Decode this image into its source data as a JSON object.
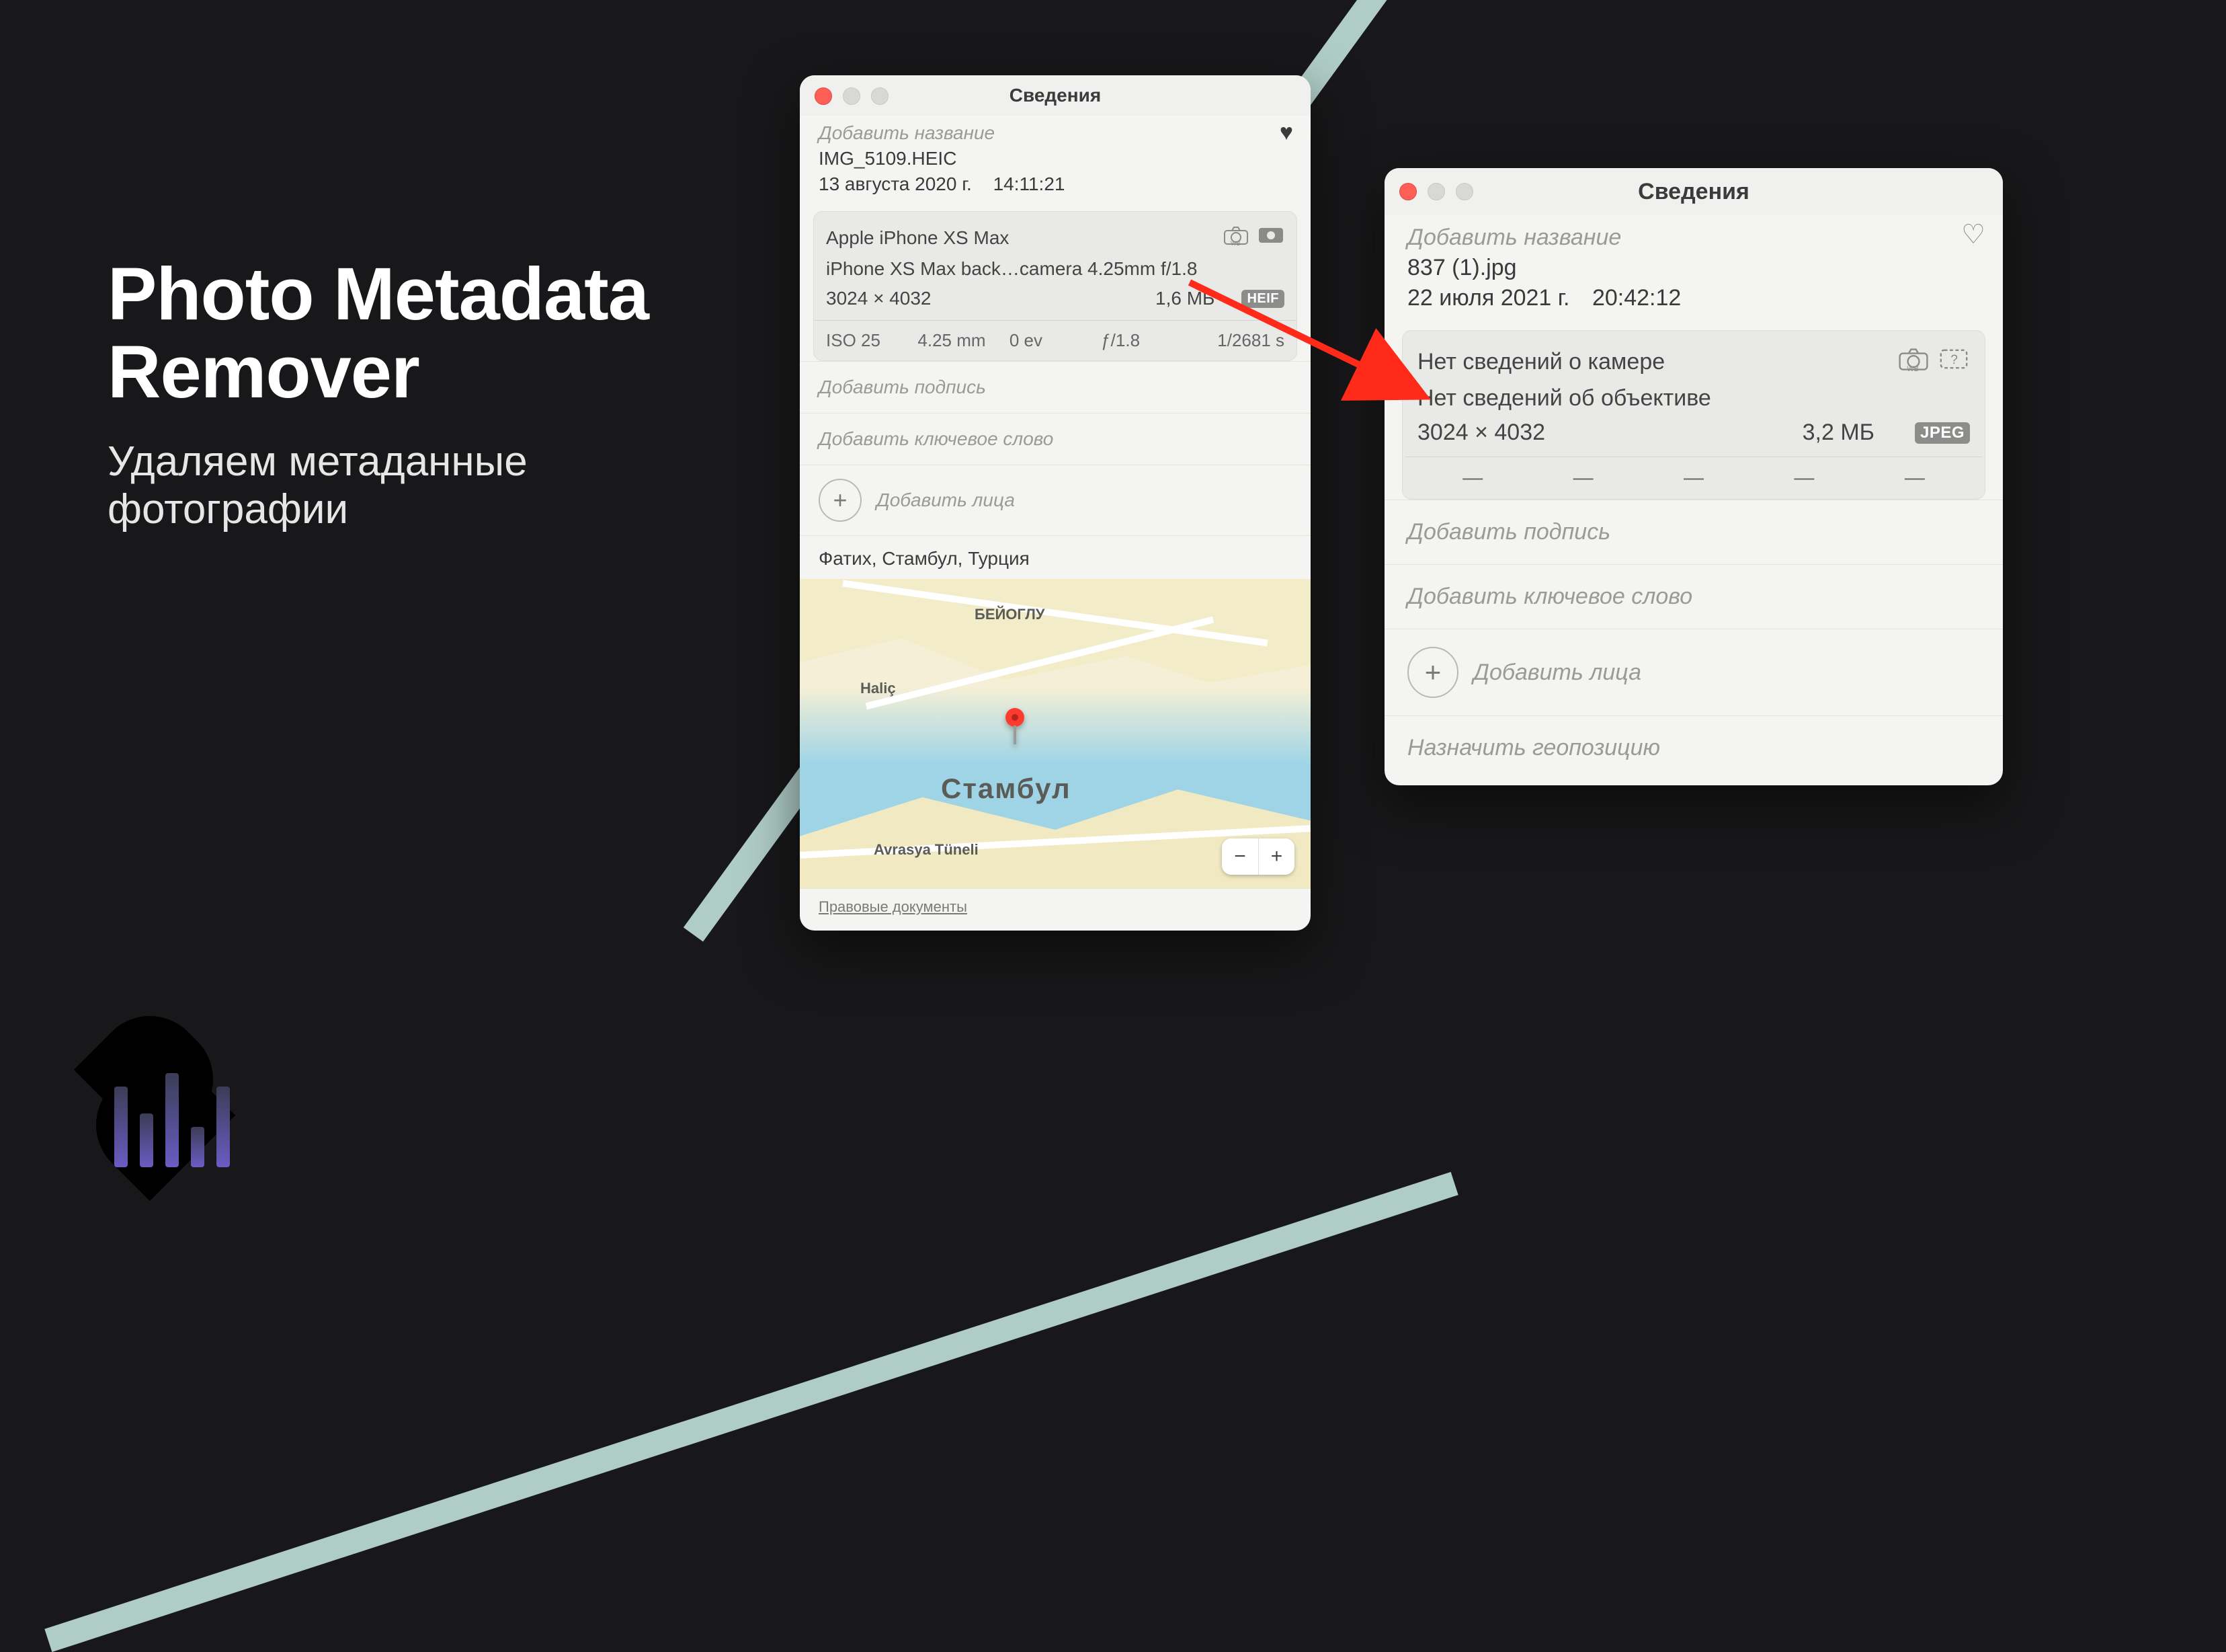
{
  "hero": {
    "title_l1": "Photo Metadata",
    "title_l2": "Remover",
    "subtitle_l1": "Удаляем метаданные",
    "subtitle_l2": "фотографии"
  },
  "panel_left": {
    "window_title": "Сведения",
    "add_title": "Добавить название",
    "filename": "IMG_5109.HEIC",
    "date": "13 августа 2020 г.",
    "time": "14:11:21",
    "favorite": true,
    "camera_model": "Apple iPhone XS Max",
    "lens": "iPhone XS Max back…camera 4.25mm f/1.8",
    "dimensions": "3024 × 4032",
    "filesize": "1,6 МБ",
    "format_badge": "HEIF",
    "exif": {
      "iso": "ISO 25",
      "focal": "4.25 mm",
      "ev": "0 ev",
      "aperture": "ƒ/1.8",
      "shutter": "1/2681 s"
    },
    "add_caption": "Добавить подпись",
    "add_keyword": "Добавить ключевое слово",
    "add_faces": "Добавить лица",
    "location": "Фатих, Стамбул, Турция",
    "map": {
      "city": "Стамбул",
      "label1": "БЕЙОГЛУ",
      "label2": "Haliç",
      "label3": "Avrasya Tüneli"
    },
    "legal": "Правовые документы"
  },
  "panel_right": {
    "window_title": "Сведения",
    "add_title": "Добавить название",
    "filename": "837 (1).jpg",
    "date": "22 июля 2021 г.",
    "time": "20:42:12",
    "favorite": false,
    "no_camera": "Нет сведений о камере",
    "no_lens": "Нет сведений об объективе",
    "dimensions": "3024 × 4032",
    "filesize": "3,2 МБ",
    "format_badge": "JPEG",
    "add_caption": "Добавить подпись",
    "add_keyword": "Добавить ключевое слово",
    "add_faces": "Добавить лица",
    "assign_geo": "Назначить геопозицию"
  },
  "dash": "—"
}
